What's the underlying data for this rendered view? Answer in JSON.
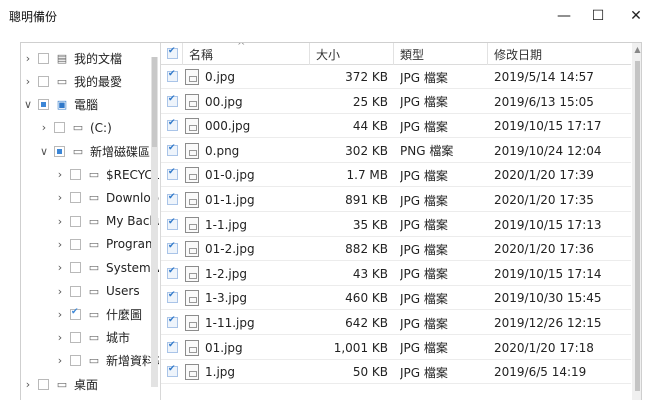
{
  "window": {
    "title": "聰明備份",
    "minimize_glyph": "—",
    "maximize_glyph": "☐",
    "close_glyph": "✕"
  },
  "tree": [
    {
      "label": "我的文檔",
      "icon": "document-icon",
      "expanded": false,
      "check": "none"
    },
    {
      "label": "我的最愛",
      "icon": "folder-icon",
      "expanded": false,
      "check": "none"
    },
    {
      "label": "電腦",
      "icon": "computer-icon",
      "expanded": true,
      "check": "partial"
    },
    {
      "label": "(C:)",
      "icon": "drive-icon",
      "expanded": false,
      "check": "none"
    },
    {
      "label": "新增磁碟區 (",
      "icon": "drive-icon",
      "expanded": true,
      "check": "partial"
    },
    {
      "label": "$RECYCLE",
      "icon": "folder-icon",
      "expanded": false,
      "check": "none"
    },
    {
      "label": "Download",
      "icon": "folder-icon",
      "expanded": false,
      "check": "none"
    },
    {
      "label": "My Backu",
      "icon": "folder-icon",
      "expanded": false,
      "check": "none"
    },
    {
      "label": "Program",
      "icon": "folder-icon",
      "expanded": false,
      "check": "none"
    },
    {
      "label": "System Vo",
      "icon": "folder-icon",
      "expanded": false,
      "check": "none"
    },
    {
      "label": "Users",
      "icon": "folder-icon",
      "expanded": false,
      "check": "none"
    },
    {
      "label": "什麼圖",
      "icon": "folder-icon",
      "expanded": false,
      "check": "on"
    },
    {
      "label": "城市",
      "icon": "folder-icon",
      "expanded": false,
      "check": "none"
    },
    {
      "label": "新增資料夾",
      "icon": "folder-icon",
      "expanded": false,
      "check": "none"
    },
    {
      "label": "桌面",
      "icon": "folder-icon",
      "expanded": false,
      "check": "none"
    }
  ],
  "columns": {
    "name": "名稱",
    "size": "大小",
    "type": "類型",
    "modified": "修改日期"
  },
  "files": [
    {
      "name": "0.jpg",
      "size": "372 KB",
      "type": "JPG 檔案",
      "modified": "2019/5/14 14:57"
    },
    {
      "name": "00.jpg",
      "size": "25 KB",
      "type": "JPG 檔案",
      "modified": "2019/6/13 15:05"
    },
    {
      "name": "000.jpg",
      "size": "44 KB",
      "type": "JPG 檔案",
      "modified": "2019/10/15 17:17"
    },
    {
      "name": "0.png",
      "size": "302 KB",
      "type": "PNG 檔案",
      "modified": "2019/10/24 12:04"
    },
    {
      "name": "01-0.jpg",
      "size": "1.7 MB",
      "type": "JPG 檔案",
      "modified": "2020/1/20 17:39"
    },
    {
      "name": "01-1.jpg",
      "size": "891 KB",
      "type": "JPG 檔案",
      "modified": "2020/1/20 17:35"
    },
    {
      "name": "1-1.jpg",
      "size": "35 KB",
      "type": "JPG 檔案",
      "modified": "2019/10/15 17:13"
    },
    {
      "name": "01-2.jpg",
      "size": "882 KB",
      "type": "JPG 檔案",
      "modified": "2020/1/20 17:36"
    },
    {
      "name": "1-2.jpg",
      "size": "43 KB",
      "type": "JPG 檔案",
      "modified": "2019/10/15 17:14"
    },
    {
      "name": "1-3.jpg",
      "size": "460 KB",
      "type": "JPG 檔案",
      "modified": "2019/10/30 15:45"
    },
    {
      "name": "1-11.jpg",
      "size": "642 KB",
      "type": "JPG 檔案",
      "modified": "2019/12/26 12:15"
    },
    {
      "name": "01.jpg",
      "size": "1,001 KB",
      "type": "JPG 檔案",
      "modified": "2020/1/20 17:18"
    },
    {
      "name": "1.jpg",
      "size": "50 KB",
      "type": "JPG 檔案",
      "modified": "2019/6/5 14:19"
    }
  ]
}
